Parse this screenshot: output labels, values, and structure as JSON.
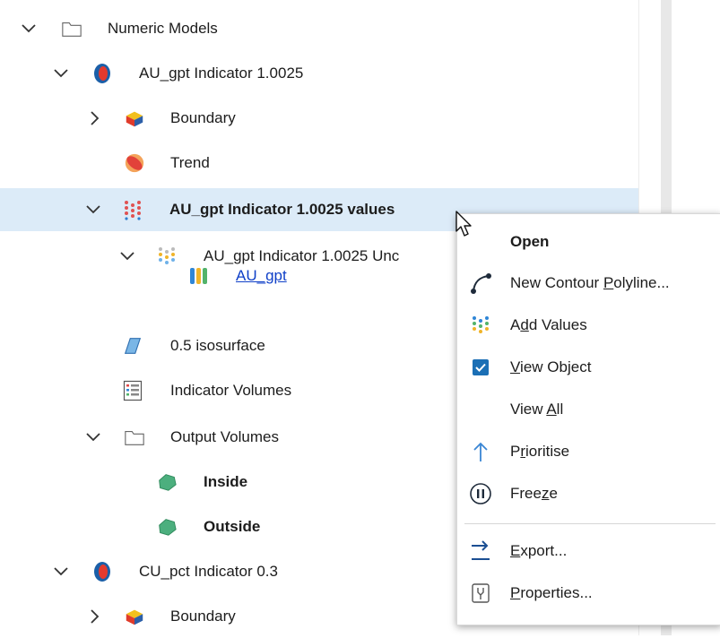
{
  "tree": {
    "numeric_models": "Numeric Models",
    "au_indicator": "AU_gpt Indicator 1.0025",
    "boundary_1": "Boundary",
    "trend": "Trend",
    "au_values": "AU_gpt Indicator 1.0025 values",
    "au_unc": "AU_gpt Indicator 1.0025 Unc",
    "au_gpt": "AU_gpt",
    "isosurface": "0.5 isosurface",
    "indicator_volumes": "Indicator Volumes",
    "output_volumes": "Output Volumes",
    "inside": "Inside",
    "outside": "Outside",
    "cu_indicator": "CU_pct Indicator 0.3",
    "boundary_2": "Boundary"
  },
  "menu": {
    "open": "Open",
    "new_contour_pre": "New Contour ",
    "new_contour_u": "P",
    "new_contour_post": "olyline...",
    "add_values_pre": "A",
    "add_values_u": "d",
    "add_values_post": "d Values",
    "view_object_u": "V",
    "view_object_post": "iew Object",
    "view_all_pre": "View ",
    "view_all_u": "A",
    "view_all_post": "ll",
    "prioritise_pre": "P",
    "prioritise_u": "r",
    "prioritise_post": "ioritise",
    "freeze_pre": "Free",
    "freeze_u": "z",
    "freeze_post": "e",
    "export_u": "E",
    "export_post": "xport...",
    "properties_u": "P",
    "properties_post": "roperties..."
  },
  "colors": {
    "selection": "#dcebf8",
    "accent": "#1b6fb5",
    "link": "#1040c8"
  }
}
